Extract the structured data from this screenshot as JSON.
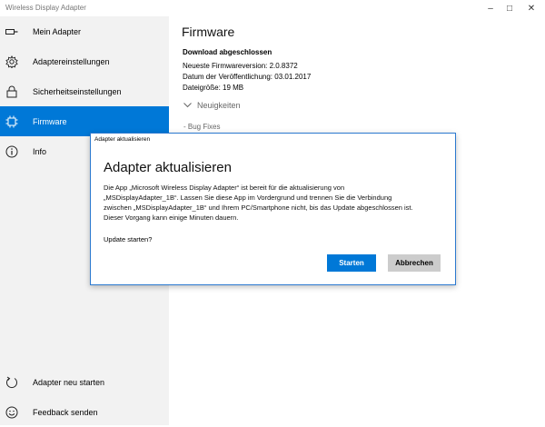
{
  "window": {
    "title": "Wireless Display Adapter",
    "controls": {
      "minimize": "–",
      "maximize": "□",
      "close": "✕"
    }
  },
  "sidebar": {
    "items": [
      {
        "label": "Mein Adapter",
        "icon": "display-adapter-icon"
      },
      {
        "label": "Adaptereinstellungen",
        "icon": "gear-icon"
      },
      {
        "label": "Sicherheitseinstellungen",
        "icon": "lock-icon"
      },
      {
        "label": "Firmware",
        "icon": "chip-icon",
        "active": true
      },
      {
        "label": "Info",
        "icon": "info-icon"
      }
    ],
    "bottom_items": [
      {
        "label": "Adapter neu starten",
        "icon": "restart-icon"
      },
      {
        "label": "Feedback senden",
        "icon": "smiley-icon"
      }
    ],
    "accent": "#0078d7"
  },
  "main": {
    "title": "Firmware",
    "status_heading": "Download abgeschlossen",
    "info_lines": [
      "Neueste Firmwareversion:  2.0.8372",
      "Datum der Veröffentlichung: 03.01.2017",
      "Dateigröße: 19 MB"
    ],
    "expander_label": "Neuigkeiten",
    "bug_fixes": "- Bug Fixes"
  },
  "dialog": {
    "window_title": "Adapter aktualisieren",
    "heading": "Adapter aktualisieren",
    "body_lines": [
      "Die App „Microsoft Wireless Display Adapter“ ist bereit für die aktualisierung von",
      "„MSDisplayAdapter_1B“. Lassen Sie diese App im Vordergrund und trennen Sie die Verbindung",
      "zwischen „MSDisplayAdapter_1B“ und Ihrem PC/Smartphone nicht, bis das Update abgeschlossen ist.",
      "Dieser Vorgang kann einige Minuten dauern."
    ],
    "question": "Update starten?",
    "primary_label": "Starten",
    "secondary_label": "Abbrechen"
  }
}
